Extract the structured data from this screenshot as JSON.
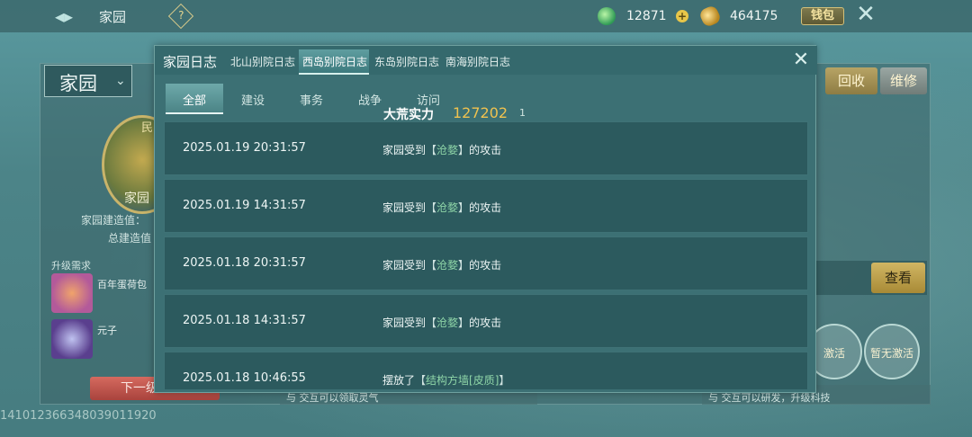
{
  "topbar": {
    "title": "家园",
    "help_icon": "?",
    "gem_value": "12871",
    "gold_value": "464175",
    "wallet_label": "钱包"
  },
  "home": {
    "dropdown_label": "家园",
    "emblem_tag": "民",
    "emblem_label": "家园",
    "build_value_label": "家园建造值：",
    "total_build_label": "总建造值",
    "upgrade_title": "升级需求",
    "req1_name": "百年蛋荷包",
    "req2_name": "元子",
    "next_level_label": "下一级",
    "recycle_label": "回收",
    "repair_label": "维修",
    "view_label": "查看",
    "activate1_label": "激活",
    "activate2_label": "暂无激活",
    "note1": "与       交互可以领取灵气",
    "note2": "与       交互可以研发，升级科技",
    "footer_id": "141012366348039011920"
  },
  "modal": {
    "title": "家园日志",
    "tabs": [
      "北山别院日志",
      "西岛别院日志",
      "东岛别院日志",
      "南海别院日志"
    ],
    "active_tab": 1,
    "subtabs": [
      "全部",
      "建设",
      "事务",
      "战争",
      "访问"
    ],
    "active_subtab": 0,
    "strength_label": "大荒实力",
    "strength_value": "127202",
    "strength_sub": "1",
    "logs": [
      {
        "time": "2025.01.19 20:31:57",
        "prefix": "家园受到",
        "lb": "【",
        "target": "沧婺",
        "rb": "】",
        "suffix": "的攻击"
      },
      {
        "time": "2025.01.19 14:31:57",
        "prefix": "家园受到",
        "lb": "【",
        "target": "沧婺",
        "rb": "】",
        "suffix": "的攻击"
      },
      {
        "time": "2025.01.18 20:31:57",
        "prefix": "家园受到",
        "lb": "【",
        "target": "沧婺",
        "rb": "】",
        "suffix": "的攻击"
      },
      {
        "time": "2025.01.18 14:31:57",
        "prefix": "家园受到",
        "lb": "【",
        "target": "沧婺",
        "rb": "】",
        "suffix": "的攻击"
      },
      {
        "time": "2025.01.18 10:46:55",
        "prefix": "摆放了",
        "lb": "【",
        "target": "结构方墙[皮质]",
        "rb": "】",
        "suffix": ""
      }
    ]
  }
}
